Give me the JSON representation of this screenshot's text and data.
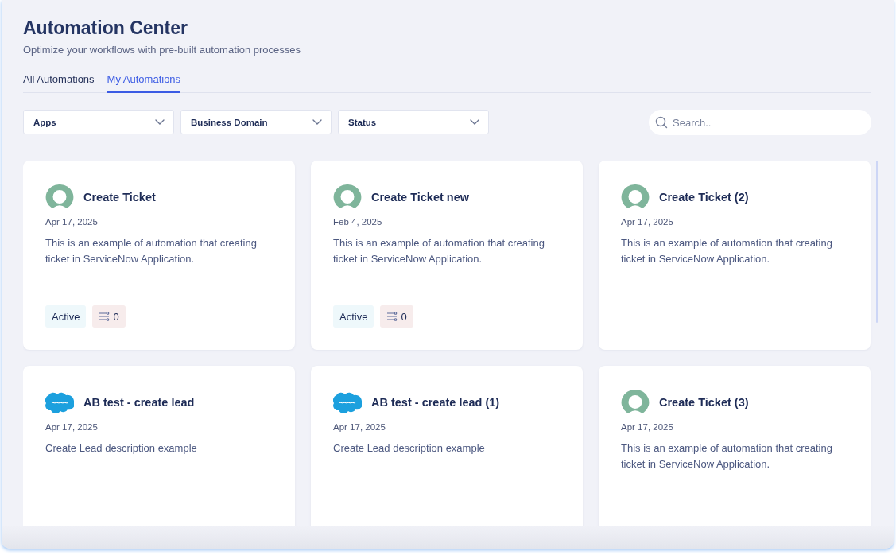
{
  "header": {
    "title": "Automation Center",
    "subtitle": "Optimize your workflows with pre-built automation processes"
  },
  "tabs": [
    {
      "label": "All Automations",
      "selected": false
    },
    {
      "label": "My Automations",
      "selected": true
    }
  ],
  "filters": [
    {
      "label": "Apps"
    },
    {
      "label": "Business Domain"
    },
    {
      "label": "Status"
    }
  ],
  "search": {
    "placeholder": "Search.."
  },
  "cards": [
    {
      "kind": "servicenow",
      "title": "Create Ticket",
      "date": "Apr 17, 2025",
      "description": "This is an example of automation that creating ticket in ServiceNow Application.",
      "status": "Active",
      "count": "0"
    },
    {
      "kind": "servicenow",
      "title": "Create Ticket new",
      "date": "Feb 4, 2025",
      "description": "This is an example of automation that creating ticket in ServiceNow Application.",
      "status": "Active",
      "count": "0"
    },
    {
      "kind": "servicenow",
      "title": "Create Ticket (2)",
      "date": "Apr 17, 2025",
      "description": "This is an example of automation that creating ticket in ServiceNow Application."
    },
    {
      "kind": "salesforce",
      "title": "AB test - create lead",
      "date": "Apr 17, 2025",
      "description": "Create Lead description example"
    },
    {
      "kind": "salesforce",
      "title": "AB test - create lead (1)",
      "date": "Apr 17, 2025",
      "description": "Create Lead description example"
    },
    {
      "kind": "servicenow",
      "title": "Create Ticket (3)",
      "date": "Apr 17, 2025",
      "description": "This is an example of automation that creating ticket in ServiceNow Application."
    }
  ]
}
